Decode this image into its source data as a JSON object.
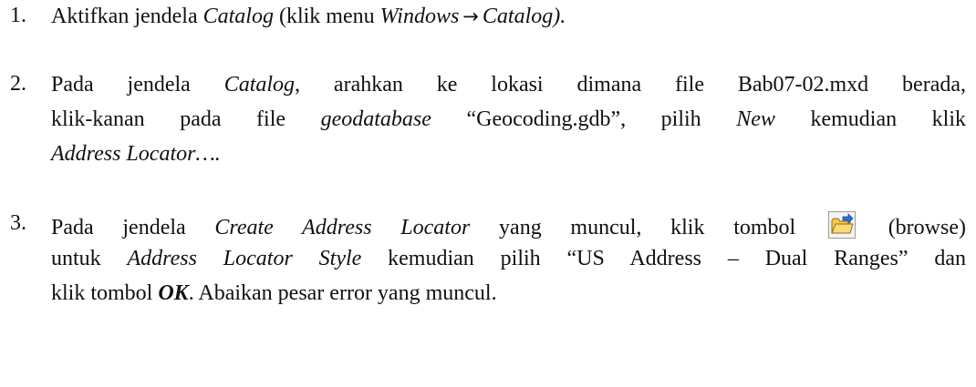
{
  "steps": [
    {
      "number": "1.",
      "text_1": "Aktifkan jendela ",
      "catalog": "Catalog",
      "text_2": " (klik menu ",
      "windows": "Windows",
      "arrow": "→",
      "catalog_close": "Catalog).",
      "icon": "right-arrow-icon"
    },
    {
      "number": "2.",
      "l1_text_1": "Pada jendela ",
      "l1_catalog": "Catalog",
      "l1_text_2": ", arahkan ke lokasi dimana file Bab07-02.mxd berada,",
      "l2_text_1": "klik-kanan pada file ",
      "l2_geodatabase": "geodatabase",
      "l2_text_2": " “Geocoding.gdb”, pilih ",
      "l2_new": "New",
      "l2_text_3": " kemudian klik",
      "l3_address_locator": "Address Locator…."
    },
    {
      "number": "3.",
      "l1_text_1": "Pada jendela ",
      "l1_create_locator": "Create Address Locator",
      "l1_text_2": " yang muncul, klik tombol",
      "l1_browse": "(browse)",
      "l2_text_1": "untuk ",
      "l2_style": "Address Locator Style",
      "l2_text_2": " kemudian pilih “US Address – Dual Ranges” dan",
      "l3_text_1": "klik tombol ",
      "l3_ok": "OK",
      "l3_text_2": ". Abaikan pesar error yang muncul.",
      "icon": "open-folder-browse-icon",
      "icon_colors": {
        "folder": "#f2c84b",
        "folder_edge": "#9a6a12",
        "arrow": "#2a6fd6"
      }
    }
  ]
}
